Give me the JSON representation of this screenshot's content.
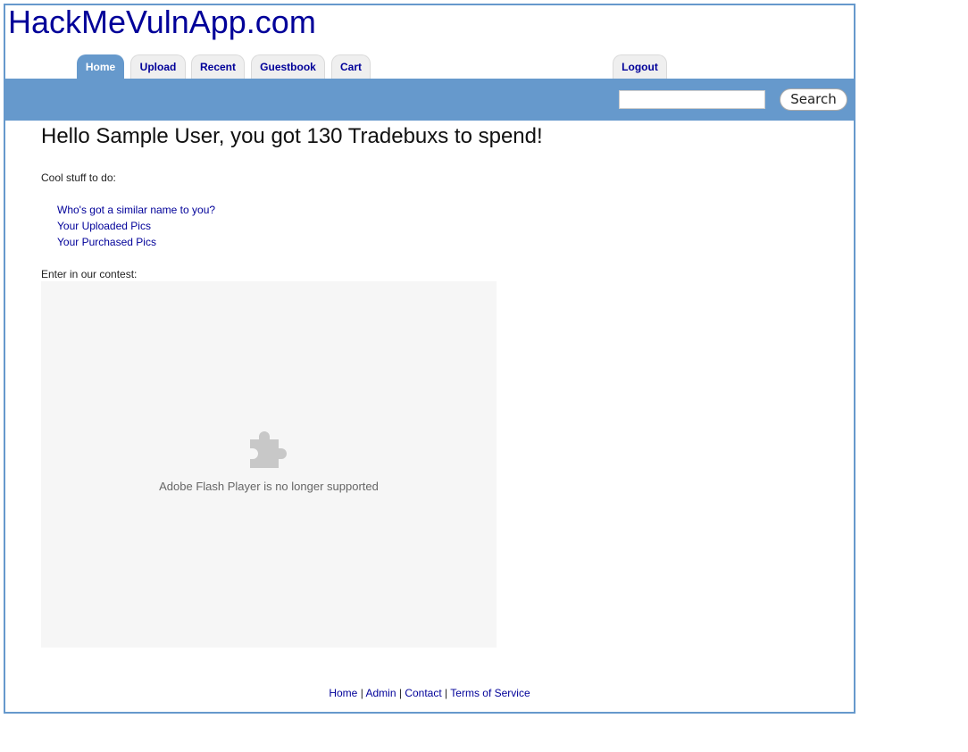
{
  "site": {
    "title": "HackMeVulnApp.com"
  },
  "nav": {
    "tabs": [
      {
        "label": "Home",
        "active": true
      },
      {
        "label": "Upload"
      },
      {
        "label": "Recent"
      },
      {
        "label": "Guestbook"
      },
      {
        "label": "Cart"
      }
    ],
    "logout_label": "Logout"
  },
  "search": {
    "value": "",
    "placeholder": "",
    "button_label": "Search"
  },
  "main": {
    "greeting": "Hello Sample User, you got 130 Tradebuxs to spend!",
    "cool_stuff_label": "Cool stuff to do:",
    "links": [
      "Who's got a similar name to you?",
      "Your Uploaded Pics",
      "Your Purchased Pics"
    ],
    "contest_label": "Enter in our contest:",
    "flash": {
      "icon": "puzzle-piece-icon",
      "message": "Adobe Flash Player is no longer supported"
    }
  },
  "footer": {
    "links": [
      "Home",
      "Admin",
      "Contact",
      "Terms of Service"
    ],
    "separator": "|"
  },
  "colors": {
    "brand_blue": "#6699cc",
    "link_navy": "#000099",
    "tab_inactive": "#efefef",
    "flash_bg": "#f6f6f6"
  }
}
